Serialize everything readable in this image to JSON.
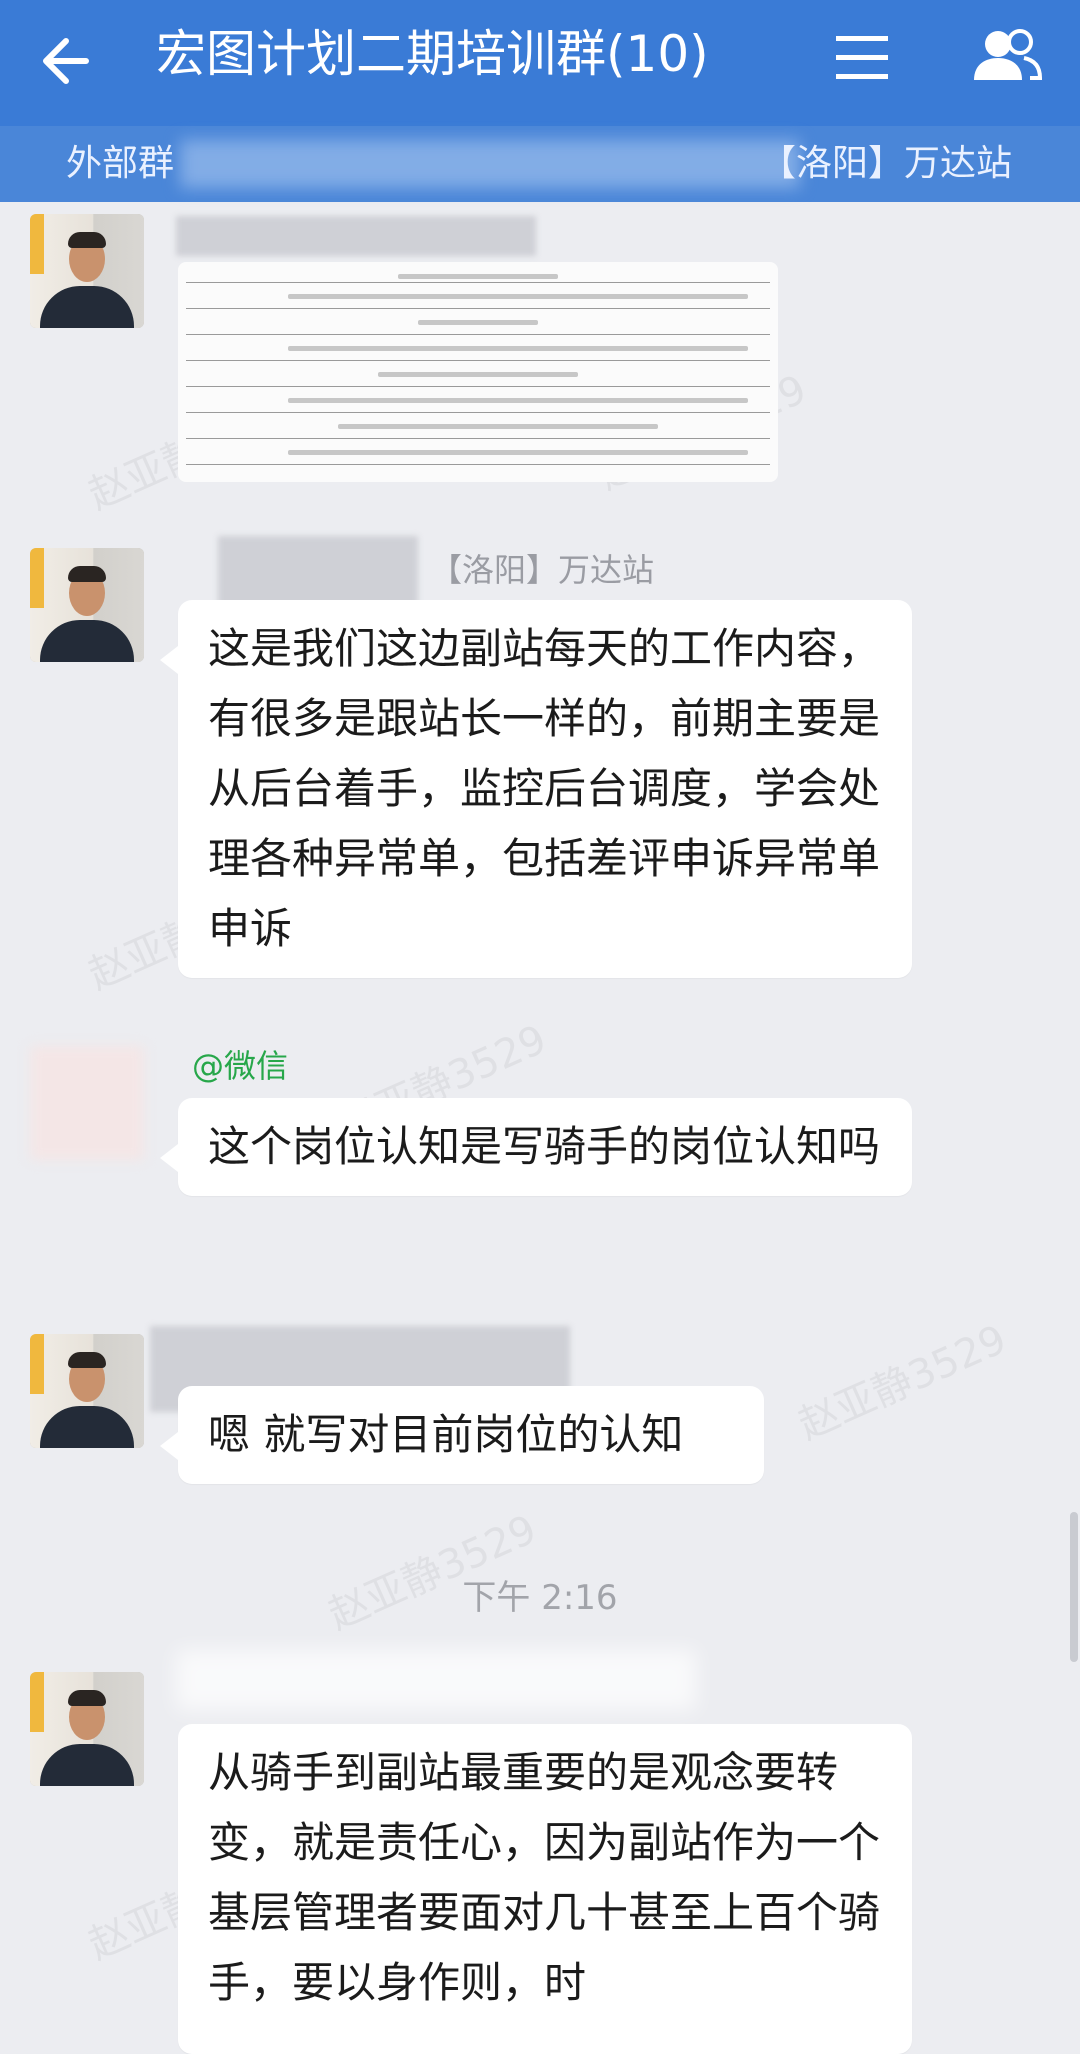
{
  "header": {
    "title": "宏图计划二期培训群(10)",
    "back_icon": "arrow-left-icon",
    "menu_icon": "hamburger-menu-icon",
    "members_icon": "group-members-icon",
    "background": "#3a7bd6"
  },
  "subbar": {
    "left": "外部群",
    "right": "【洛阳】万达站"
  },
  "messages": [
    {
      "sender": "",
      "type": "image"
    },
    {
      "sender": "【洛阳】万达站",
      "text": "这是我们这边副站每天的工作内容，有很多是跟站长一样的，前期主要是从后台着手，监控后台调度，学会处理各种异常单，包括差评申诉异常单申诉"
    },
    {
      "sender": "@微信",
      "text": "这个岗位认知是写骑手的岗位认知吗"
    },
    {
      "sender": "",
      "text": "嗯 就写对目前岗位的认知"
    },
    {
      "sender": "",
      "text": "从骑手到副站最重要的是观念要转变，就是责任心，因为副站作为一个基层管理者要面对几十甚至上百个骑手，要以身作则，时"
    }
  ],
  "time_divider": "下午 2:16",
  "watermark": "赵亚静3529"
}
